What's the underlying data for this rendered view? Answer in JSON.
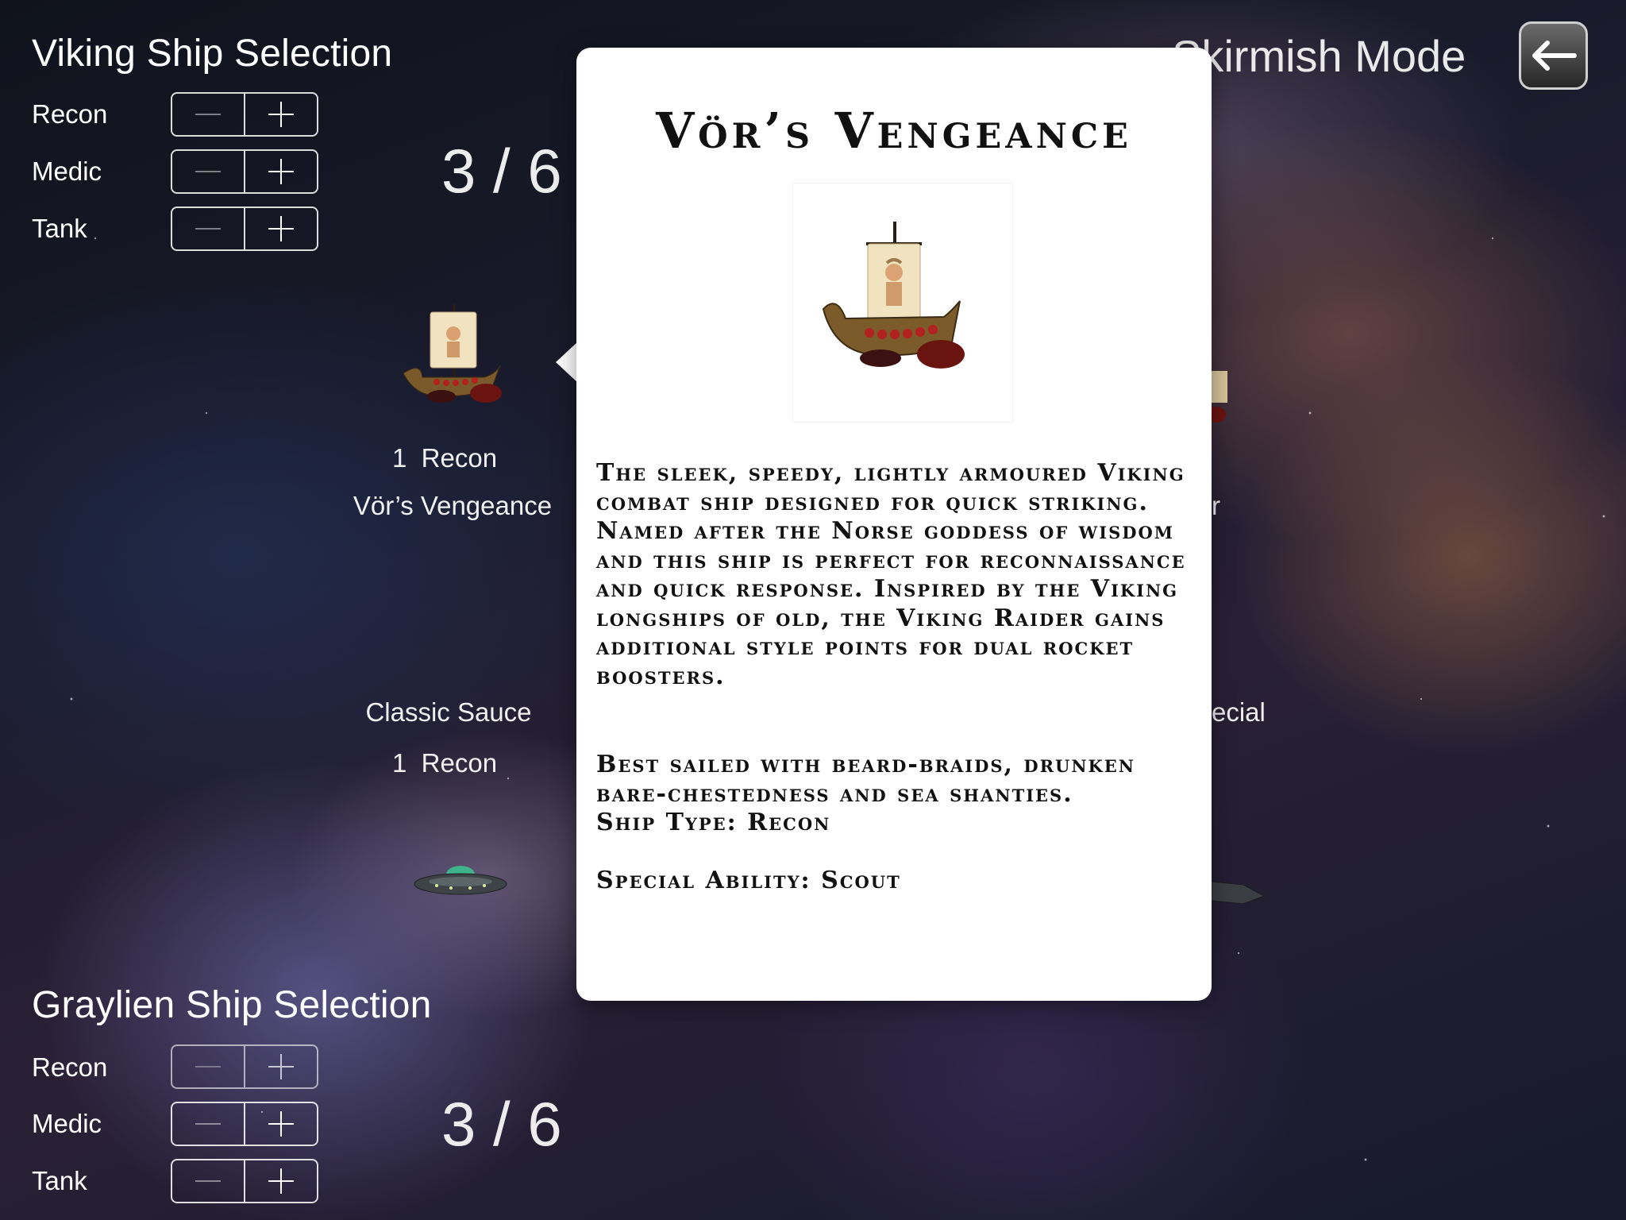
{
  "viking": {
    "title": "Viking Ship Selection",
    "rows": [
      {
        "label": "Recon"
      },
      {
        "label": "Medic"
      },
      {
        "label": "Tank"
      }
    ],
    "count": "3 / 6"
  },
  "graylien": {
    "title": "Graylien Ship Selection",
    "rows": [
      {
        "label": "Recon"
      },
      {
        "label": "Medic"
      },
      {
        "label": "Tank"
      }
    ],
    "count": "3 / 6"
  },
  "mode_title": "Skirmish Mode",
  "ships": {
    "vors": {
      "qty": "1",
      "type": "Recon",
      "name": "Vör’s Vengeance"
    },
    "classic": {
      "name": "Classic Sauce",
      "qty": "1",
      "type": "Recon"
    },
    "right_partial_name": "r",
    "right_partial_type": "ecial"
  },
  "popup": {
    "title": "Vör’s Vengeance",
    "description": "The sleek, speedy, lightly armoured Viking combat ship designed for quick striking. Named after the Norse goddess of wisdom and this ship is perfect for reconnaissance and quick response. Inspired by the Viking longships of old, the Viking Raider gains additional style points for dual rocket boosters.",
    "tagline": "Best sailed with beard-braids, drunken bare-chestedness and sea shanties.",
    "ship_type": "Ship Type: Recon",
    "special_ability": "Special Ability: Scout"
  },
  "icons": {
    "back": "back-arrow-icon",
    "viking_ship": "viking-longship-icon",
    "ufo": "ufo-saucer-icon"
  },
  "colors": {
    "popup_bg": "#ffffff",
    "text_light": "#ffffff",
    "popup_text": "#111111"
  }
}
